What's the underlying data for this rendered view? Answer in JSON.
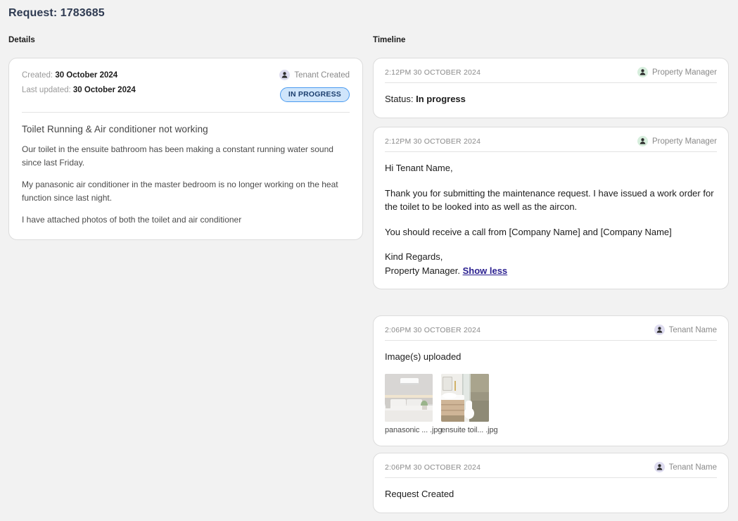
{
  "header": {
    "title": "Request: 1783685"
  },
  "columns": {
    "details_label": "Details",
    "timeline_label": "Timeline"
  },
  "colors": {
    "page_background": "#f2f2f2",
    "card_background": "#ffffff",
    "card_border": "#dcdcdc",
    "title": "#2f3b52",
    "badge_background": "#cfe5fb",
    "badge_border": "#4a9bf0",
    "badge_text": "#1c3f6e",
    "link": "#2a1f8f",
    "avatar_green": "#d7eedd",
    "avatar_purple": "#dedcf0"
  },
  "details": {
    "created_label": "Created:",
    "created_value": "30 October 2024",
    "updated_label": "Last updated:",
    "updated_value": "30 October 2024",
    "author": {
      "name": "Tenant Created",
      "avatar": "person-icon",
      "avatar_tone": "purple"
    },
    "status_badge": "IN PROGRESS",
    "request_title": "Toilet Running & Air conditioner not working",
    "paragraphs": [
      "Our toilet in the ensuite bathroom has been making a constant running water sound since last Friday.",
      "My panasonic air conditioner in the master bedroom is no longer working on the heat function since last night.",
      "I have attached photos of both the toilet and air conditioner"
    ]
  },
  "timeline": {
    "entries": [
      {
        "timestamp": "2:12PM 30 OCTOBER 2024",
        "author": {
          "name": "Property Manager",
          "avatar": "person-icon",
          "avatar_tone": "green"
        },
        "status_prefix": "Status:",
        "status_value": "In progress"
      },
      {
        "timestamp": "2:12PM 30 OCTOBER 2024",
        "author": {
          "name": "Property Manager",
          "avatar": "person-icon",
          "avatar_tone": "green"
        },
        "greeting": "Hi Tenant Name,",
        "body_1": "Thank you for submitting the maintenance request. I have issued a work order for the toilet to be looked into as well as the aircon.",
        "body_2": "You should receive a call from [Company Name] and [Company Name]",
        "signoff_1": "Kind Regards,",
        "signoff_2": "Property Manager.",
        "show_less_label": "Show less"
      },
      {
        "timestamp": "2:06PM 30 OCTOBER 2024",
        "author": {
          "name": "Tenant Name",
          "avatar": "person-icon",
          "avatar_tone": "purple"
        },
        "body": "Image(s) uploaded",
        "attachments": [
          {
            "name": "panasonic ... .jpg",
            "subject": "bedroom-air-conditioner-photo"
          },
          {
            "name": "ensuite toil... .jpg",
            "subject": "ensuite-bathroom-toilet-photo"
          }
        ]
      },
      {
        "timestamp": "2:06PM 30 OCTOBER 2024",
        "author": {
          "name": "Tenant Name",
          "avatar": "person-icon",
          "avatar_tone": "purple"
        },
        "body": "Request Created"
      }
    ]
  }
}
